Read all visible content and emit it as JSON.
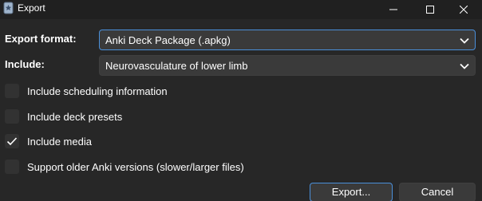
{
  "window": {
    "title": "Export",
    "controls": [
      "minimize-icon",
      "maximize-icon",
      "close-icon"
    ]
  },
  "export_format": {
    "label": "Export format:",
    "value": "Anki Deck Package (.apkg)"
  },
  "include": {
    "label": "Include:",
    "value": "Neurovasculature of lower limb"
  },
  "options": [
    {
      "label": "Include scheduling information",
      "checked": false
    },
    {
      "label": "Include deck presets",
      "checked": false
    },
    {
      "label": "Include media",
      "checked": true
    },
    {
      "label": "Support older Anki versions (slower/larger files)",
      "checked": false
    }
  ],
  "buttons": {
    "export": "Export...",
    "cancel": "Cancel"
  },
  "colors": {
    "background": "#272727",
    "titlebar": "#202020",
    "focus_accent": "#4a8fd9"
  }
}
